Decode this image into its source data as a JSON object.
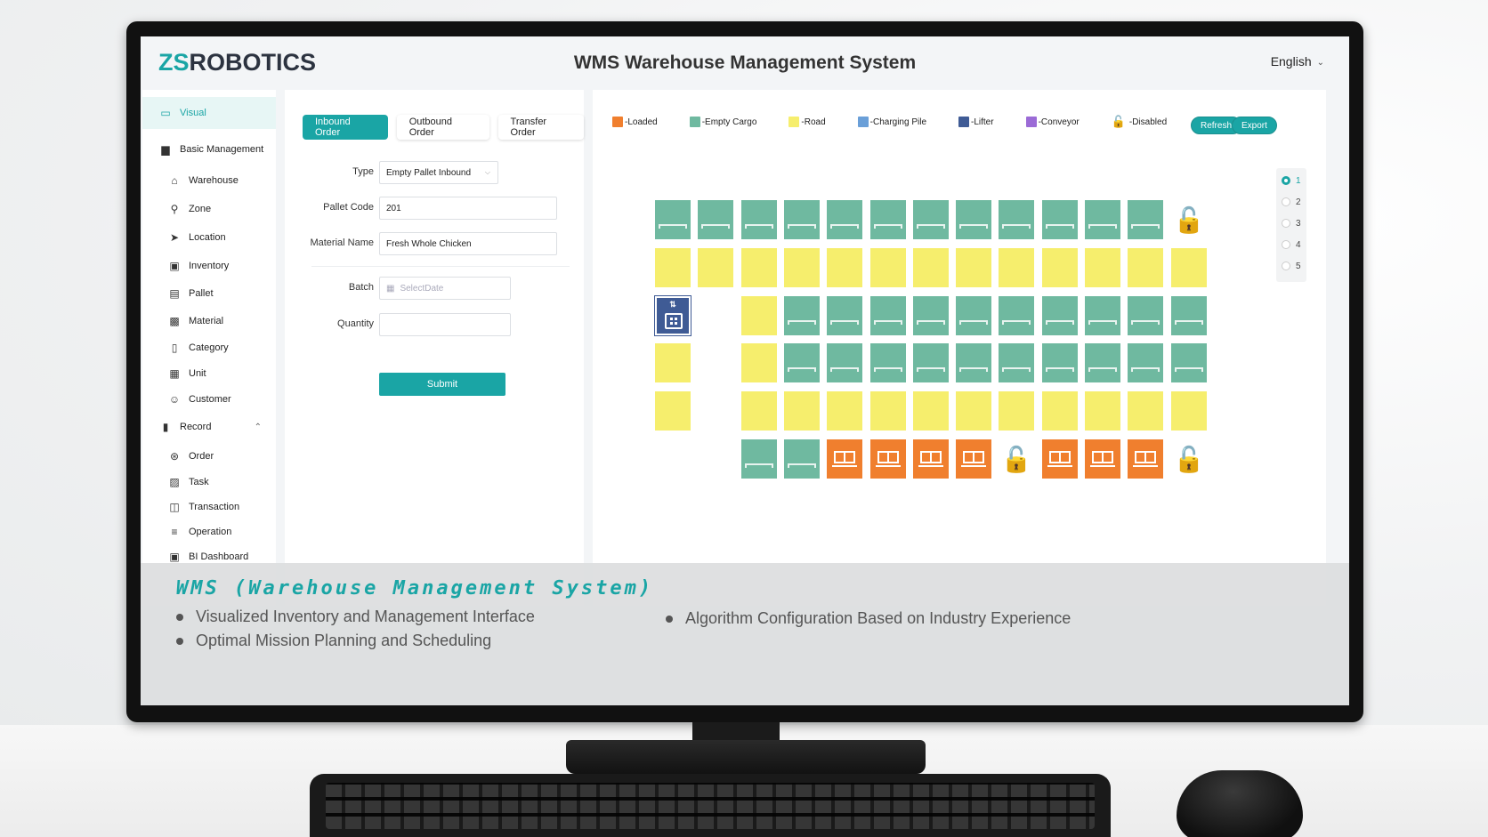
{
  "header": {
    "logo_prefix": "ZS",
    "logo_suffix": "ROBOTICS",
    "title": "WMS Warehouse Management System",
    "language": "English"
  },
  "sidebar": {
    "items": [
      {
        "label": "Visual",
        "icon": "monitor-icon",
        "level": 1,
        "active": true
      },
      {
        "label": "Basic Management",
        "icon": "bar-chart-icon",
        "level": 1
      },
      {
        "label": "Warehouse",
        "icon": "home-icon",
        "level": 2
      },
      {
        "label": "Zone",
        "icon": "zone-icon",
        "level": 2
      },
      {
        "label": "Location",
        "icon": "send-icon",
        "level": 2
      },
      {
        "label": "Inventory",
        "icon": "bag-icon",
        "level": 2
      },
      {
        "label": "Pallet",
        "icon": "pallet-icon",
        "level": 2
      },
      {
        "label": "Material",
        "icon": "shopping-bag-icon",
        "level": 2
      },
      {
        "label": "Category",
        "icon": "bookmark-icon",
        "level": 2
      },
      {
        "label": "Unit",
        "icon": "unit-icon",
        "level": 2
      },
      {
        "label": "Customer",
        "icon": "user-icon",
        "level": 2
      },
      {
        "label": "Record",
        "icon": "book-icon",
        "level": 1,
        "expanded": true
      },
      {
        "label": "Order",
        "icon": "cart-icon",
        "level": 2
      },
      {
        "label": "Task",
        "icon": "clipboard-icon",
        "level": 2
      },
      {
        "label": "Transaction",
        "icon": "transaction-icon",
        "level": 2
      },
      {
        "label": "Operation",
        "icon": "sliders-icon",
        "level": 2
      },
      {
        "label": "BI Dashboard",
        "icon": "dashboard-icon",
        "level": 2
      }
    ]
  },
  "form": {
    "tabs": [
      {
        "label": "Inbound Order",
        "active": true
      },
      {
        "label": "Outbound Order"
      },
      {
        "label": "Transfer Order"
      }
    ],
    "fields": {
      "type": {
        "label": "Type",
        "value": "Empty Pallet Inbound"
      },
      "pallet_code": {
        "label": "Pallet Code",
        "value": "201"
      },
      "material_name": {
        "label": "Material Name",
        "value": "Fresh Whole Chicken"
      },
      "batch": {
        "label": "Batch",
        "placeholder": "SelectDate"
      },
      "quantity": {
        "label": "Quantity",
        "value": ""
      }
    },
    "submit_label": "Submit"
  },
  "map": {
    "legend": [
      {
        "label": "-Loaded",
        "color": "#f07f2e",
        "icon": "loaded-icon"
      },
      {
        "label": "-Empty Cargo",
        "color": "#6fb9a0",
        "icon": "empty-cargo-icon"
      },
      {
        "label": "-Road",
        "color": "#f6ee6d",
        "icon": "road-icon"
      },
      {
        "label": "-Charging Pile",
        "color": "#6a9fd8",
        "icon": "charging-pile-icon"
      },
      {
        "label": "-Lifter",
        "color": "#3f5b95",
        "icon": "lifter-icon"
      },
      {
        "label": "-Conveyor",
        "color": "#9b6bd6",
        "icon": "conveyor-icon"
      },
      {
        "label": "-Disabled",
        "color": "#e02020",
        "icon": "lock-icon"
      }
    ],
    "refresh_label": "Refresh",
    "export_label": "Export",
    "levels": [
      "1",
      "2",
      "3",
      "4",
      "5"
    ],
    "selected_level": "1",
    "grid": [
      [
        "E",
        "E",
        "E",
        "E",
        "E",
        "E",
        "E",
        "E",
        "E",
        "E",
        "E",
        "E",
        "D"
      ],
      [
        "R",
        "R",
        "R",
        "R",
        "R",
        "R",
        "R",
        "R",
        "R",
        "R",
        "R",
        "R",
        "R"
      ],
      [
        "L",
        "-",
        "R",
        "E",
        "E",
        "E",
        "E",
        "E",
        "E",
        "E",
        "E",
        "E",
        "E"
      ],
      [
        "R",
        "-",
        "R",
        "E",
        "E",
        "E",
        "E",
        "E",
        "E",
        "E",
        "E",
        "E",
        "E"
      ],
      [
        "R",
        "-",
        "R",
        "R",
        "R",
        "R",
        "R",
        "R",
        "R",
        "R",
        "R",
        "R",
        "R"
      ],
      [
        "-",
        "-",
        "E",
        "E",
        "O",
        "O",
        "O",
        "O",
        "D",
        "O",
        "O",
        "O",
        "D"
      ]
    ]
  },
  "banner": {
    "title": "WMS (Warehouse Management System)",
    "bullets": [
      "Visualized Inventory and Management Interface",
      "Optimal Mission Planning and Scheduling",
      "Algorithm Configuration Based on Industry Experience"
    ]
  },
  "colors": {
    "accent": "#1aa5a5",
    "empty_cargo": "#6fb9a0",
    "road": "#f6ee6d",
    "loaded": "#f07f2e",
    "disabled": "#e02020",
    "lifter": "#3f5b95"
  }
}
